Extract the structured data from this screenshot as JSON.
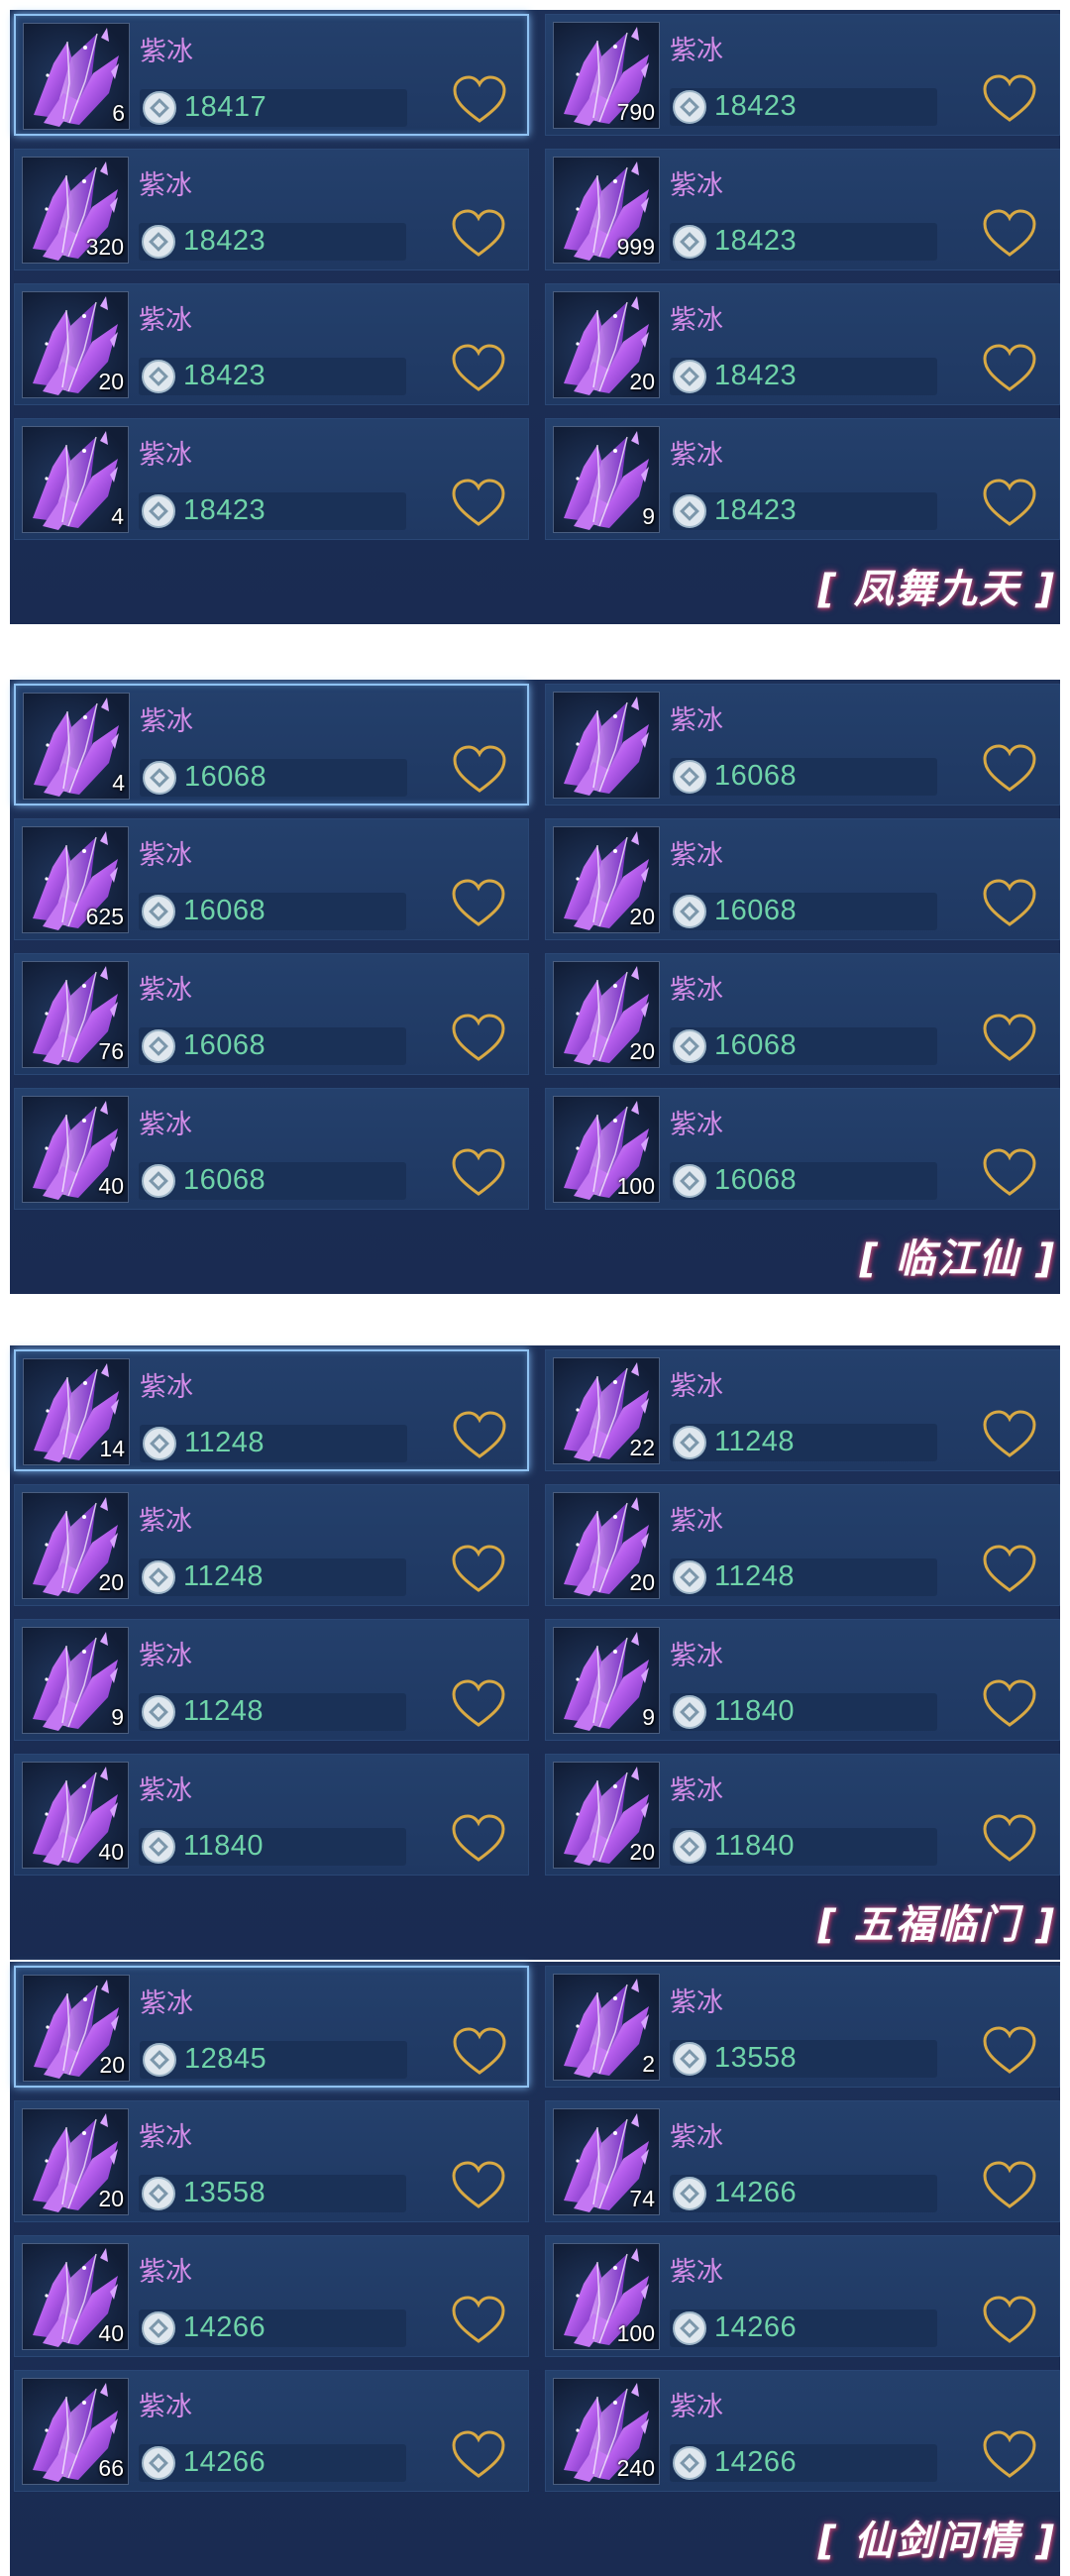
{
  "colors": {
    "name": "#d38ce8",
    "price": "#6fd3a9",
    "heart": "#d8a944",
    "selected_border": "#8fc2f2"
  },
  "panels": [
    {
      "label": "[ 凤舞九天 ]",
      "items": [
        {
          "name": "紫冰",
          "qty": "6",
          "price": "18417",
          "selected": true
        },
        {
          "name": "紫冰",
          "qty": "790",
          "price": "18423"
        },
        {
          "name": "紫冰",
          "qty": "320",
          "price": "18423"
        },
        {
          "name": "紫冰",
          "qty": "999",
          "price": "18423"
        },
        {
          "name": "紫冰",
          "qty": "20",
          "price": "18423"
        },
        {
          "name": "紫冰",
          "qty": "20",
          "price": "18423"
        },
        {
          "name": "紫冰",
          "qty": "4",
          "price": "18423"
        },
        {
          "name": "紫冰",
          "qty": "9",
          "price": "18423"
        }
      ]
    },
    {
      "label": "[ 临江仙 ]",
      "items": [
        {
          "name": "紫冰",
          "qty": "4",
          "price": "16068",
          "selected": true
        },
        {
          "name": "紫冰",
          "qty": "",
          "price": "16068"
        },
        {
          "name": "紫冰",
          "qty": "625",
          "price": "16068"
        },
        {
          "name": "紫冰",
          "qty": "20",
          "price": "16068"
        },
        {
          "name": "紫冰",
          "qty": "76",
          "price": "16068"
        },
        {
          "name": "紫冰",
          "qty": "20",
          "price": "16068"
        },
        {
          "name": "紫冰",
          "qty": "40",
          "price": "16068"
        },
        {
          "name": "紫冰",
          "qty": "100",
          "price": "16068"
        }
      ]
    },
    {
      "label": "[ 五福临门 ]",
      "items": [
        {
          "name": "紫冰",
          "qty": "14",
          "price": "11248",
          "selected": true
        },
        {
          "name": "紫冰",
          "qty": "22",
          "price": "11248"
        },
        {
          "name": "紫冰",
          "qty": "20",
          "price": "11248"
        },
        {
          "name": "紫冰",
          "qty": "20",
          "price": "11248"
        },
        {
          "name": "紫冰",
          "qty": "9",
          "price": "11248"
        },
        {
          "name": "紫冰",
          "qty": "9",
          "price": "11840"
        },
        {
          "name": "紫冰",
          "qty": "40",
          "price": "11840"
        },
        {
          "name": "紫冰",
          "qty": "20",
          "price": "11840"
        }
      ]
    },
    {
      "label": "[ 仙剑问情 ]",
      "items": [
        {
          "name": "紫冰",
          "qty": "20",
          "price": "12845",
          "selected": true
        },
        {
          "name": "紫冰",
          "qty": "2",
          "price": "13558"
        },
        {
          "name": "紫冰",
          "qty": "20",
          "price": "13558"
        },
        {
          "name": "紫冰",
          "qty": "74",
          "price": "14266"
        },
        {
          "name": "紫冰",
          "qty": "40",
          "price": "14266"
        },
        {
          "name": "紫冰",
          "qty": "100",
          "price": "14266"
        },
        {
          "name": "紫冰",
          "qty": "66",
          "price": "14266"
        },
        {
          "name": "紫冰",
          "qty": "240",
          "price": "14266"
        }
      ]
    }
  ]
}
